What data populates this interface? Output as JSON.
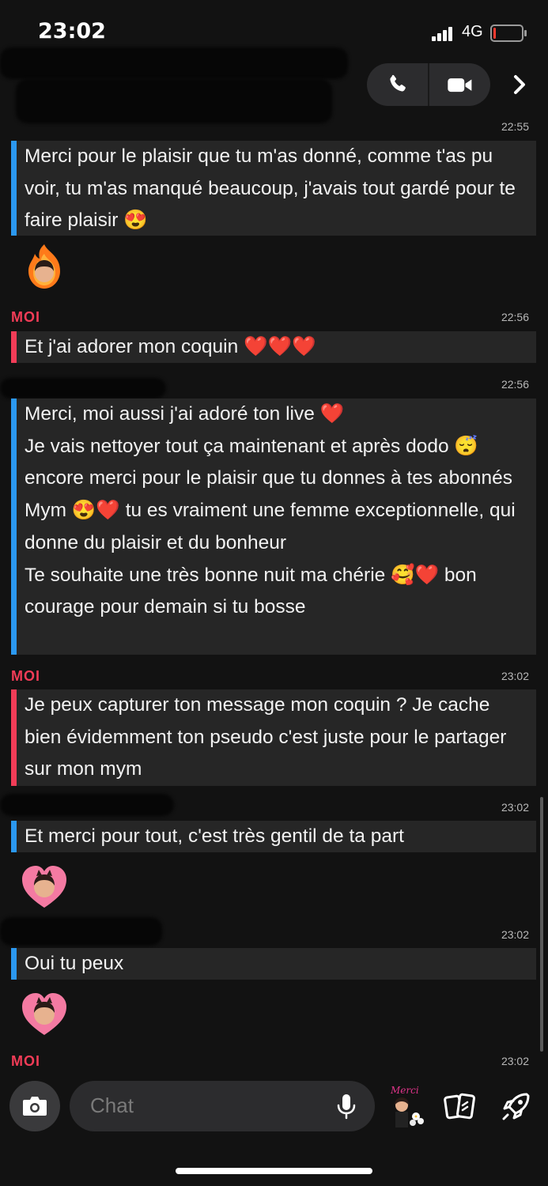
{
  "status_bar": {
    "time": "23:02",
    "network": "4G",
    "battery_level": 0.1
  },
  "header": {
    "call_icon": "phone-icon",
    "video_icon": "video-camera-icon",
    "more_icon": "chevron-right-icon"
  },
  "messages": [
    {
      "timestamp": "22:55",
      "sender": "",
      "side": "them",
      "text": "Merci pour le plaisir que tu m'as donné, comme t'as pu voir, tu m'as manqué beaucoup, j'avais tout gardé pour te faire plaisir 😍"
    },
    {
      "timestamp": "22:56",
      "sender": "MOI",
      "side": "me",
      "text": "Et j'ai adorer mon coquin ❤️❤️❤️"
    },
    {
      "timestamp": "22:56",
      "sender": "",
      "side": "them",
      "text": "Merci, moi aussi j'ai adoré ton live ❤️\nJe vais nettoyer tout ça maintenant et après dodo 😴 encore merci pour le plaisir que tu donnes à tes abonnés Mym 😍❤️ tu es vraiment une femme exceptionnelle, qui donne du plaisir et du bonheur\nTe souhaite une très bonne nuit ma chérie 🥰❤️ bon courage pour demain si tu bosse"
    },
    {
      "timestamp": "23:02",
      "sender": "MOI",
      "side": "me",
      "text": "Je peux capturer ton message mon coquin ? Je cache bien évidemment ton pseudo c'est juste pour le partager sur mon mym"
    },
    {
      "timestamp": "23:02",
      "sender": "",
      "side": "them",
      "text": "Et merci pour tout, c'est très gentil de ta part"
    },
    {
      "timestamp": "23:02",
      "sender": "",
      "side": "them",
      "text": "Oui tu peux"
    },
    {
      "timestamp": "23:02",
      "sender": "MOI",
      "side": "me",
      "text": ""
    }
  ],
  "composer": {
    "placeholder": "Chat",
    "sticker_label": "Merci",
    "camera_icon": "camera-icon",
    "mic_icon": "microphone-icon",
    "cards_icon": "cards-icon",
    "rocket_icon": "rocket-icon"
  },
  "colors": {
    "them_accent": "#2b98f0",
    "me_accent": "#f23c57",
    "bubble": "#262626",
    "background": "#121212"
  }
}
